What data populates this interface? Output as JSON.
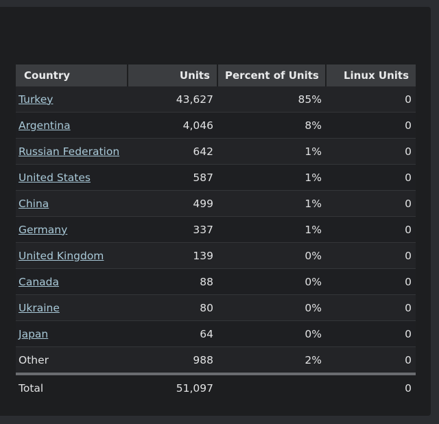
{
  "table": {
    "headers": {
      "country": "Country",
      "units": "Units",
      "percent": "Percent of Units",
      "linux": "Linux Units"
    },
    "rows": [
      {
        "country": "Turkey",
        "units": "43,627",
        "percent": "85%",
        "linux": "0"
      },
      {
        "country": "Argentina",
        "units": "4,046",
        "percent": "8%",
        "linux": "0"
      },
      {
        "country": "Russian Federation",
        "units": "642",
        "percent": "1%",
        "linux": "0"
      },
      {
        "country": "United States",
        "units": "587",
        "percent": "1%",
        "linux": "0"
      },
      {
        "country": "China",
        "units": "499",
        "percent": "1%",
        "linux": "0"
      },
      {
        "country": "Germany",
        "units": "337",
        "percent": "1%",
        "linux": "0"
      },
      {
        "country": "United Kingdom",
        "units": "139",
        "percent": "0%",
        "linux": "0"
      },
      {
        "country": "Canada",
        "units": "88",
        "percent": "0%",
        "linux": "0"
      },
      {
        "country": "Ukraine",
        "units": "80",
        "percent": "0%",
        "linux": "0"
      },
      {
        "country": "Japan",
        "units": "64",
        "percent": "0%",
        "linux": "0"
      }
    ],
    "other": {
      "country": "Other",
      "units": "988",
      "percent": "2%",
      "linux": "0"
    },
    "total": {
      "label": "Total",
      "units": "51,097",
      "linux": "0"
    }
  },
  "colors": {
    "page_bg": "#2b2d31",
    "panel_bg": "#1d1e20",
    "header_bg": "#3b3d40",
    "link": "#a9c9d8",
    "text": "#e2e3e4"
  }
}
